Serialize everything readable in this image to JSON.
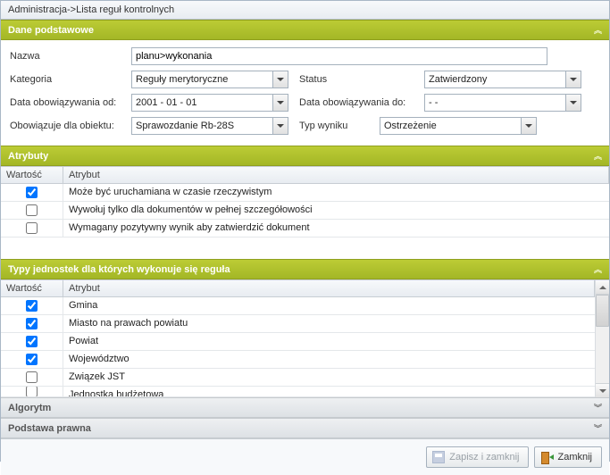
{
  "title": "Administracja->Lista reguł kontrolnych",
  "sections": {
    "basic": {
      "title": "Dane podstawowe"
    },
    "attrs": {
      "title": "Atrybuty"
    },
    "units": {
      "title": "Typy jednostek dla których wykonuje się reguła"
    },
    "algo": {
      "title": "Algorytm"
    },
    "legal": {
      "title": "Podstawa prawna"
    }
  },
  "form": {
    "name_label": "Nazwa",
    "name_value": "planu>wykonania",
    "category_label": "Kategoria",
    "category_value": "Reguły merytoryczne",
    "status_label": "Status",
    "status_value": "Zatwierdzony",
    "valid_from_label": "Data obowiązywania od:",
    "valid_from_value": "2001 - 01 - 01",
    "valid_to_label": "Data obowiązywania do:",
    "valid_to_value": "       -      -",
    "applies_label": "Obowiązuje dla obiektu:",
    "applies_value": "Sprawozdanie Rb-28S",
    "result_type_label": "Typ wyniku",
    "result_type_value": "Ostrzeżenie"
  },
  "grid1": {
    "col_value": "Wartość",
    "col_attr": "Atrybut",
    "rows": [
      {
        "checked": true,
        "label": "Może być uruchamiana w czasie rzeczywistym"
      },
      {
        "checked": false,
        "label": "Wywołuj tylko dla dokumentów w pełnej szczegółowości"
      },
      {
        "checked": false,
        "label": "Wymagany pozytywny wynik aby zatwierdzić dokument"
      }
    ]
  },
  "grid2": {
    "col_value": "Wartość",
    "col_attr": "Atrybut",
    "rows": [
      {
        "checked": true,
        "label": "Gmina"
      },
      {
        "checked": true,
        "label": "Miasto na prawach powiatu"
      },
      {
        "checked": true,
        "label": "Powiat"
      },
      {
        "checked": true,
        "label": "Województwo"
      },
      {
        "checked": false,
        "label": "Związek JST"
      },
      {
        "checked": false,
        "label": "Jednostka budżetowa"
      }
    ]
  },
  "buttons": {
    "save_close": "Zapisz i zamknij",
    "close": "Zamknij"
  }
}
